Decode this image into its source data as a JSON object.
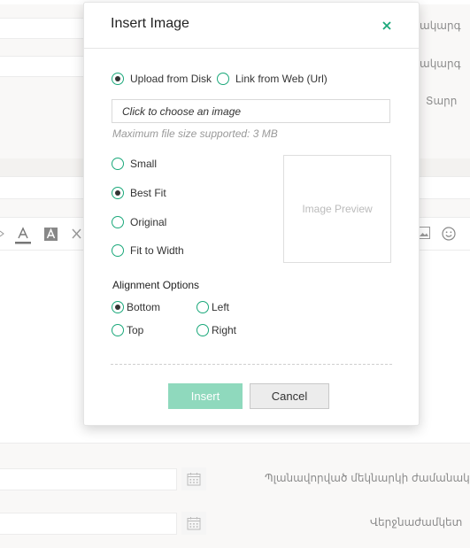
{
  "background": {
    "labels": {
      "row1": "ակարգ",
      "row2": "ակարգ",
      "row3": "Տարր",
      "date1": "Պլանավորված մեկնարկի ժամանակը",
      "date2": "Վերջնաժամկետ"
    }
  },
  "icons": {
    "close": "close-icon",
    "font_color": "font-color-icon",
    "highlight": "highlight-icon",
    "clear_format": "clear-format-icon",
    "image": "image-icon",
    "emoji": "emoji-icon",
    "calendar": "calendar-icon"
  },
  "colors": {
    "accent": "#1aa87a",
    "insert_button": "#8fd9bd",
    "cancel_button": "#ececec"
  },
  "dialog": {
    "title": "Insert Image",
    "source_options": [
      {
        "label": "Upload from Disk",
        "selected": true
      },
      {
        "label": "Link from Web (Url)",
        "selected": false
      }
    ],
    "file_placeholder": "Click to choose an image",
    "max_size_hint": "Maximum file size supported: 3 MB",
    "size_options": [
      {
        "label": "Small",
        "selected": false
      },
      {
        "label": "Best Fit",
        "selected": true
      },
      {
        "label": "Original",
        "selected": false
      },
      {
        "label": "Fit to Width",
        "selected": false
      }
    ],
    "preview_label": "Image Preview",
    "alignment_title": "Alignment Options",
    "alignment_options": [
      {
        "label": "Bottom",
        "selected": true
      },
      {
        "label": "Left",
        "selected": false
      },
      {
        "label": "Top",
        "selected": false
      },
      {
        "label": "Right",
        "selected": false
      }
    ],
    "insert_label": "Insert",
    "cancel_label": "Cancel"
  }
}
